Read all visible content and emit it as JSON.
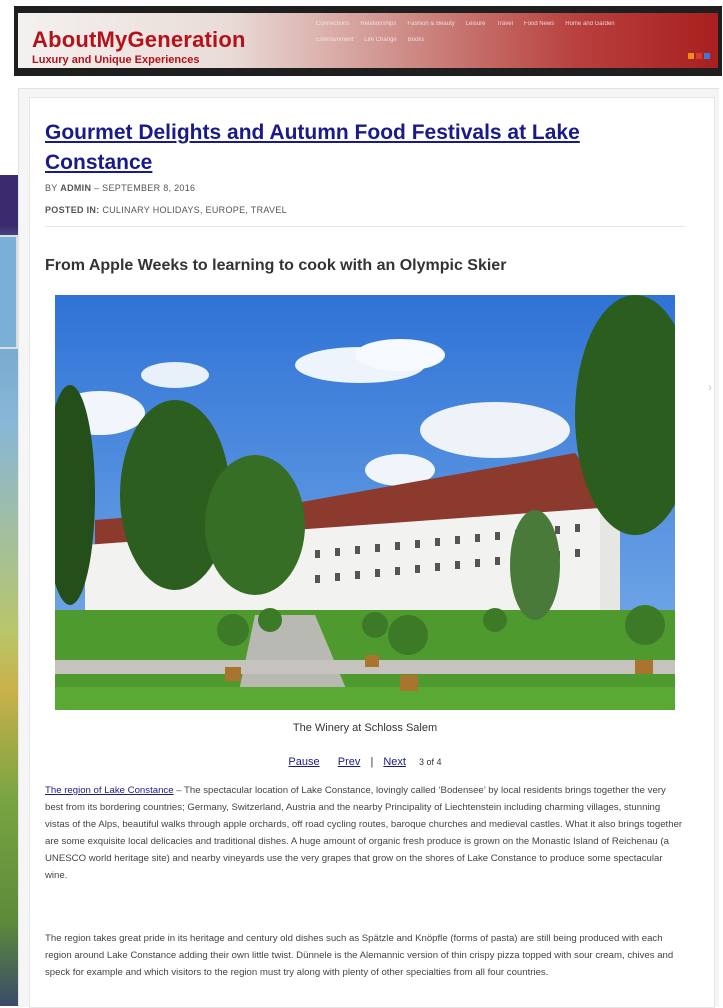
{
  "header": {
    "logo_title": "AboutMyGeneration",
    "logo_tagline": "Luxury and Unique Experiences",
    "nav_row1": [
      "Connections",
      "Relationships",
      "Fashion & Beauty",
      "Leisure",
      "Travel",
      "Food News",
      "Home and Garden"
    ],
    "nav_row2": [
      "Entertainment",
      "Life Change",
      "Books"
    ],
    "social_colors": [
      "#f08a1c",
      "#d83a2a",
      "#3b7ad8"
    ]
  },
  "post": {
    "title": "Gourmet Delights and Autumn Food Festivals at Lake Constance",
    "byline_prefix": "BY",
    "author": "ADMIN",
    "date": "– SEPTEMBER 8, 2016",
    "posted_label": "POSTED IN:",
    "categories": "CULINARY HOLIDAYS, EUROPE, TRAVEL",
    "subheading": "From Apple Weeks to learning to cook with an Olympic Skier"
  },
  "slideshow": {
    "caption": "The Winery at Schloss Salem",
    "pause": "Pause",
    "prev": "Prev",
    "separator": "|",
    "next": "Next",
    "counter": "3 of 4"
  },
  "body": {
    "p1_link": "The region of Lake Constance",
    "p1_text": " – The spectacular location of Lake Constance, lovingly called ‘Bodensee’ by local residents brings together the very best from its bordering countries; Germany, Switzerland, Austria and the nearby Principality of Liechtenstein including charming villages, stunning vistas of the Alps, beautiful walks through apple orchards, off road cycling routes, baroque churches and medieval castles. What it also brings together are some exquisite local delicacies and traditional dishes. A huge amount of organic fresh produce is grown on the Monastic Island of Reichenau (a UNESCO world heritage site) and nearby vineyards use the very grapes that grow on the shores of Lake Constance to produce some spectacular wine.",
    "p2_text": "The region takes great pride in its heritage and century old dishes such as Spätzle and Knöpfle (forms of pasta) are still being produced with each region around Lake Constance adding their own little twist. Dünnele is the Alemannic version of thin crispy pizza topped with sour cream, chives and speck for example and which visitors to the region must try along with plenty of other specialties from all four countries."
  },
  "colors": {
    "brand_red": "#b3121a",
    "link_blue": "#1a1a8a"
  }
}
